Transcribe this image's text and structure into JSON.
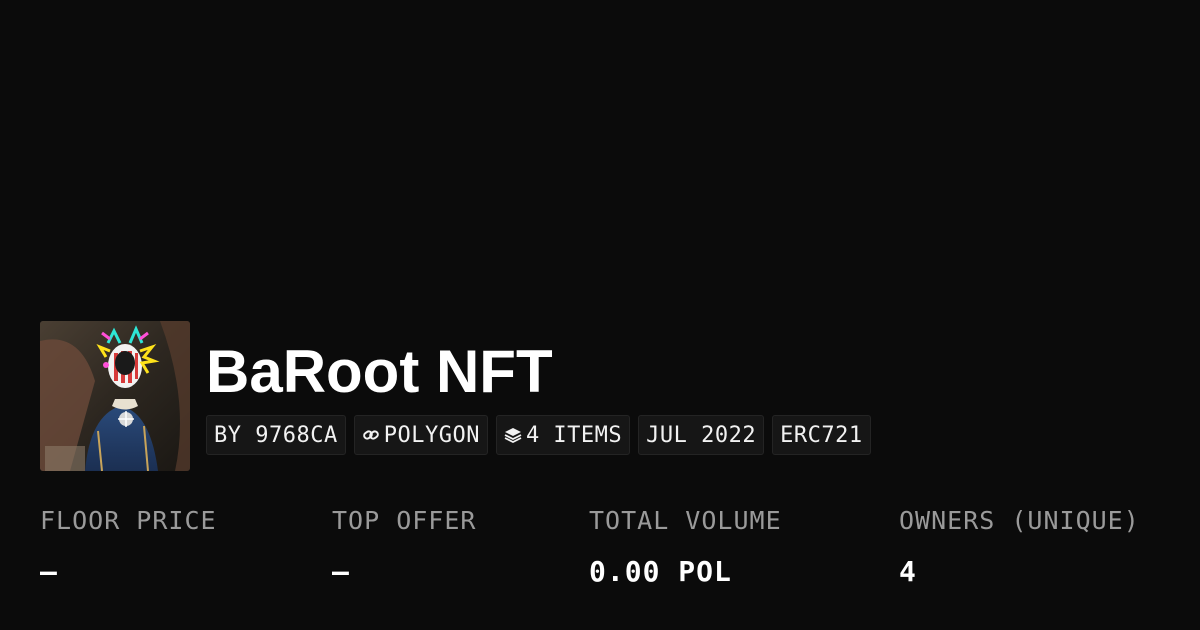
{
  "collection": {
    "name": "BaRoot NFT",
    "badges": [
      {
        "label": "BY 9768CA",
        "icon": ""
      },
      {
        "label": "POLYGON",
        "icon": "chain-link-icon"
      },
      {
        "label": "4 ITEMS",
        "icon": "layers-icon"
      },
      {
        "label": "JUL 2022",
        "icon": ""
      },
      {
        "label": "ERC721",
        "icon": ""
      }
    ]
  },
  "stats": [
    {
      "label": "FLOOR PRICE",
      "value": "–"
    },
    {
      "label": "TOP OFFER",
      "value": "–"
    },
    {
      "label": "TOTAL VOLUME",
      "value": "0.00 POL"
    },
    {
      "label": "OWNERS (UNIQUE)",
      "value": "4"
    }
  ],
  "colors": {
    "background": "#0b0b0b",
    "badge_background": "#161616",
    "label_gray": "#9a9a9a",
    "text_white": "#ffffff"
  }
}
